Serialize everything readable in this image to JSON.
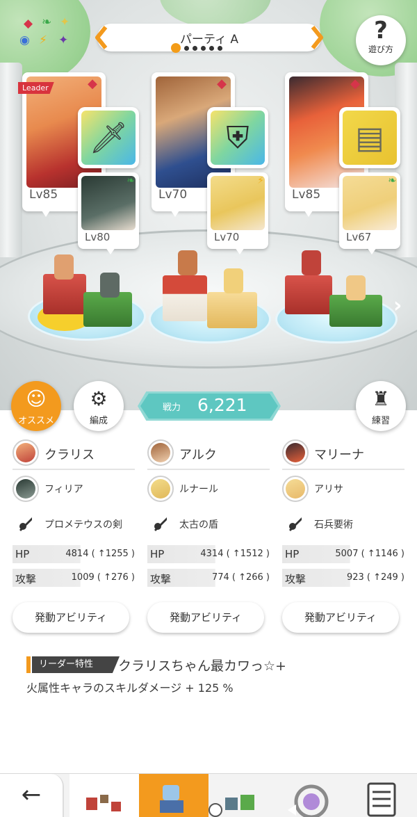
{
  "header": {
    "party_title": "パーティ A",
    "help_label": "遊び方"
  },
  "cards": [
    {
      "level": "Lv85",
      "leader": "Leader",
      "sub_level": "Lv80",
      "element_color": "#d6344a",
      "equip_icon": "sword-icon"
    },
    {
      "level": "Lv70",
      "sub_level": "Lv70",
      "element_color": "#d6344a",
      "equip_icon": "shield-icon"
    },
    {
      "level": "Lv85",
      "sub_level": "Lv67",
      "element_color": "#d6344a",
      "equip_icon": "stone-book-icon"
    }
  ],
  "buttons": {
    "recommend": "オススメ",
    "formation": "編成",
    "practice": "練習"
  },
  "power": {
    "label": "戦力",
    "value": "6,221"
  },
  "columns": [
    {
      "main": "クラリス",
      "sub": "フィリア",
      "weapon": "プロメテウスの剣",
      "hp_label": "HP",
      "hp": "4814 ( ↑1255 )",
      "atk_label": "攻撃",
      "atk": "1009 ( ↑276 )",
      "ability": "発動アビリティ"
    },
    {
      "main": "アルク",
      "sub": "ルナール",
      "weapon": "太古の盾",
      "hp_label": "HP",
      "hp": "4314 ( ↑1512 )",
      "atk_label": "攻撃",
      "atk": "774 ( ↑266 )",
      "ability": "発動アビリティ"
    },
    {
      "main": "マリーナ",
      "sub": "アリサ",
      "weapon": "石兵要術",
      "hp_label": "HP",
      "hp": "5007 ( ↑1146 )",
      "atk_label": "攻撃",
      "atk": "923 ( ↑249 )",
      "ability": "発動アビリティ"
    }
  ],
  "leader_skill": {
    "tag": "リーダー特性",
    "title": "クラリスちゃん最カワっ☆+",
    "description": "火属性キャラのスキルダメージ + 125 %"
  },
  "colors": {
    "accent": "#f39a1e",
    "power": "#5ec7c1",
    "fire": "#d6344a"
  }
}
